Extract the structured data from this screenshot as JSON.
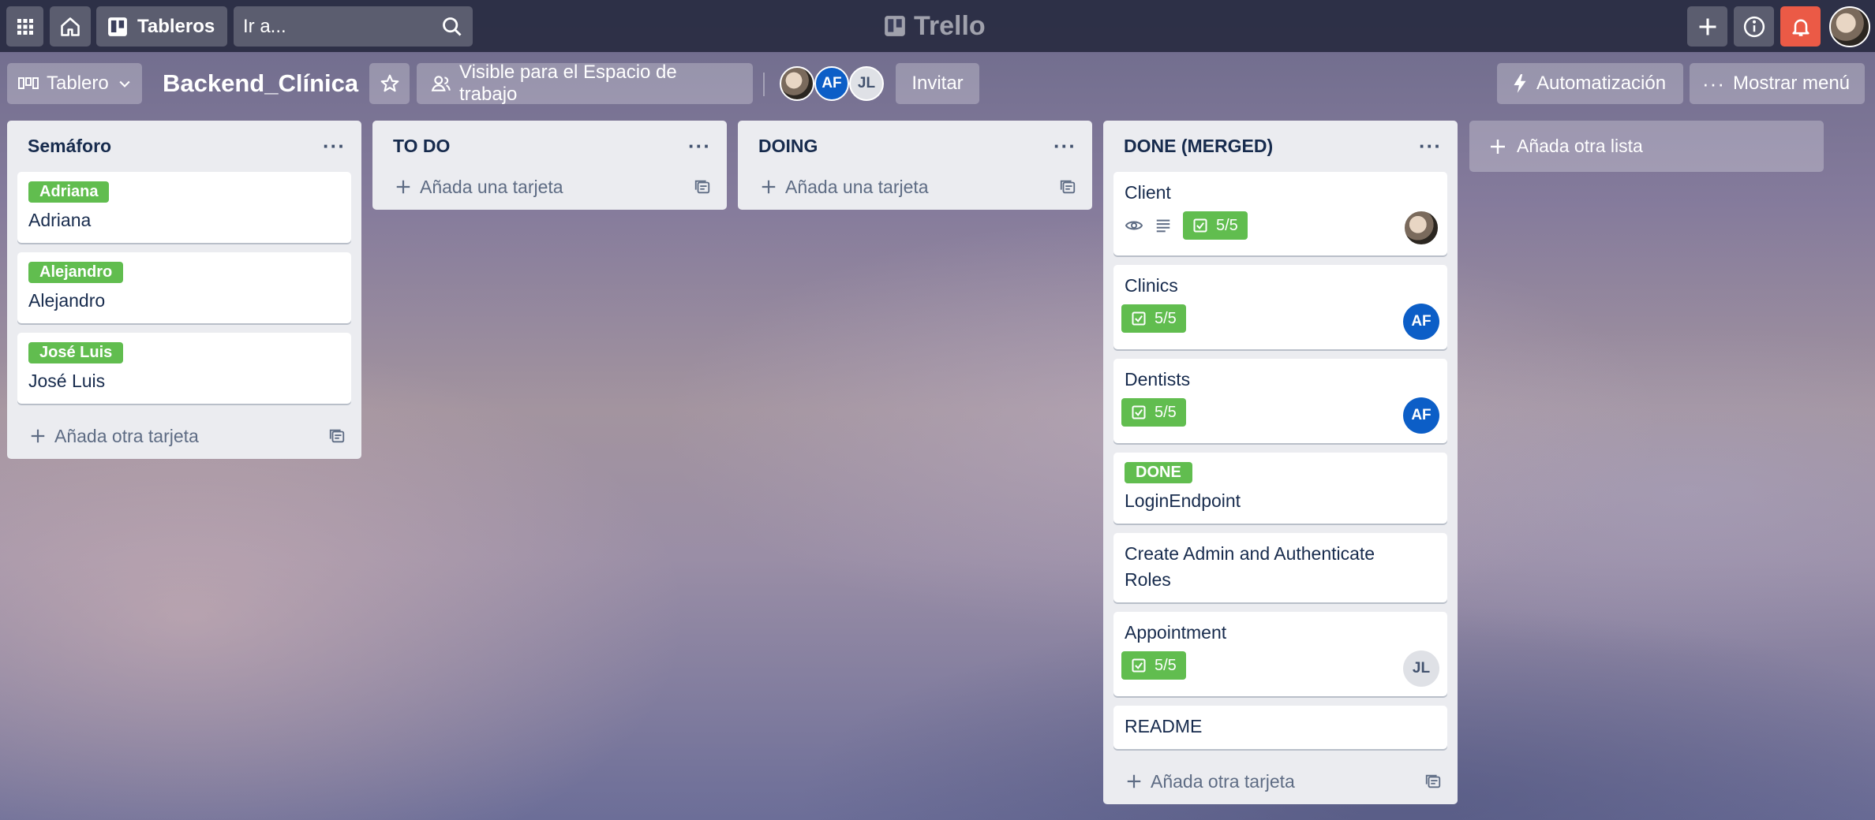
{
  "topbar": {
    "boards_label": "Tableros",
    "search_placeholder": "Ir a...",
    "logo_text": "Trello"
  },
  "board_header": {
    "view_label": "Tablero",
    "title": "Backend_Clínica",
    "visibility_label": "Visible para el Espacio de trabajo",
    "members": [
      {
        "kind": "photo",
        "initials": ""
      },
      {
        "kind": "initials",
        "initials": "AF"
      },
      {
        "kind": "initials",
        "initials": "JL"
      }
    ],
    "invite_label": "Invitar",
    "automation_label": "Automatización",
    "menu_label": "Mostrar menú"
  },
  "lists": [
    {
      "title": "Semáforo",
      "cards": [
        {
          "label": "Adriana",
          "title": "Adriana"
        },
        {
          "label": "Alejandro",
          "title": "Alejandro"
        },
        {
          "label": "José Luis",
          "title": "José Luis"
        }
      ],
      "add_label": "Añada otra tarjeta"
    },
    {
      "title": "TO DO",
      "cards": [],
      "add_label": "Añada una tarjeta"
    },
    {
      "title": "DOING",
      "cards": [],
      "add_label": "Añada una tarjeta"
    },
    {
      "title": "DONE (MERGED)",
      "cards": [
        {
          "title": "Client",
          "checklist": "5/5",
          "watch": true,
          "description": true,
          "member": "photo"
        },
        {
          "title": "Clinics",
          "checklist": "5/5",
          "member": "AF"
        },
        {
          "title": "Dentists",
          "checklist": "5/5",
          "member": "AF"
        },
        {
          "label": "DONE",
          "title": "LoginEndpoint"
        },
        {
          "title": "Create Admin and Authenticate Roles"
        },
        {
          "title": "Appointment",
          "checklist": "5/5",
          "member": "JL"
        },
        {
          "title": "README"
        }
      ],
      "add_label": "Añada otra tarjeta"
    }
  ],
  "add_list_label": "Añada otra lista",
  "colors": {
    "label_green": "#61bd4f",
    "notification_red": "#eb5a46",
    "member_blue": "#0c5ec7",
    "list_bg": "#ebecf0"
  }
}
